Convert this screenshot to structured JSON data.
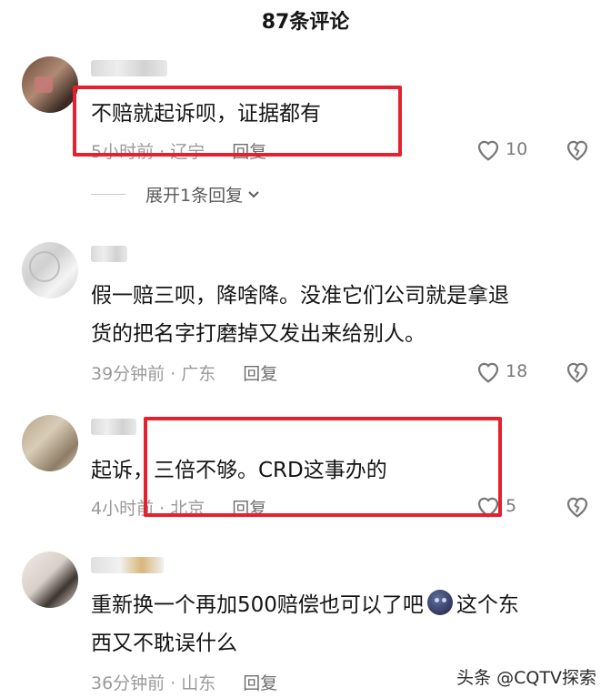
{
  "header": {
    "title": "87条评论"
  },
  "comments": [
    {
      "lines": [
        "不赔就起诉呗，证据都有"
      ],
      "meta": "5小时前 · 辽宁",
      "reply": "回复",
      "likes": "10",
      "expand": "展开1条回复"
    },
    {
      "lines": [
        "假一赔三呗，降啥降。没准它们公司就是拿退",
        "货的把名字打磨掉又发出来给别人。"
      ],
      "meta": "39分钟前 · 广东",
      "reply": "回复",
      "likes": "18"
    },
    {
      "lines": [
        "起诉，三倍不够。CRD这事办的"
      ],
      "meta": "4小时前 · 北京",
      "reply": "回复",
      "likes": "5"
    },
    {
      "line1_before": "重新换一个再加500赔偿也可以了吧",
      "line1_after": "这个东",
      "line2": "西又不耽误什么",
      "meta": "36分钟前 · 山东",
      "reply": "回复"
    }
  ],
  "watermark": "头条 @CQTV探索",
  "colors": {
    "highlight_box": "#e5212f",
    "meta_text": "#9a9a9a"
  },
  "icons": [
    "heart-outline-icon",
    "heart-broken-icon",
    "chevron-down-icon",
    "emoji-sticker-icon"
  ]
}
